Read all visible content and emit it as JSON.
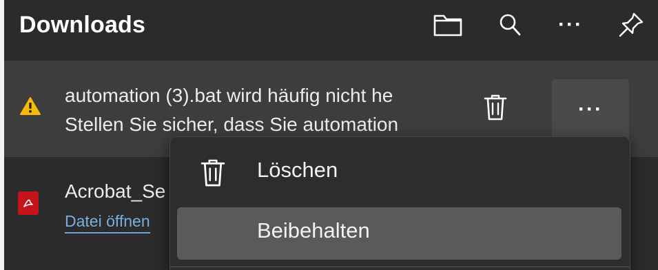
{
  "header": {
    "title": "Downloads",
    "icons": [
      "folder-icon",
      "search-icon",
      "more-icon",
      "pin-icon"
    ],
    "more_glyph": "···"
  },
  "downloads": [
    {
      "status_icon": "warning-icon",
      "line1": "automation (3).bat wird häufig nicht he",
      "line2": "Stellen Sie sicher, dass Sie automation",
      "more_glyph": "···"
    },
    {
      "file_icon": "pdf-icon",
      "name": "Acrobat_Se",
      "link": "Datei öffnen"
    }
  ],
  "context_menu": {
    "items": [
      {
        "label": "Löschen",
        "icon": "trash-icon"
      },
      {
        "label": "Beibehalten",
        "icon": ""
      }
    ]
  },
  "colors": {
    "panel_bg": "#2b2b2b",
    "selected_item_bg": "#3d3d3d",
    "menu_hover_bg": "#5a5a5a",
    "warning": "#f5b90a",
    "pdf_red": "#c4141a",
    "link": "#7aaee0"
  }
}
